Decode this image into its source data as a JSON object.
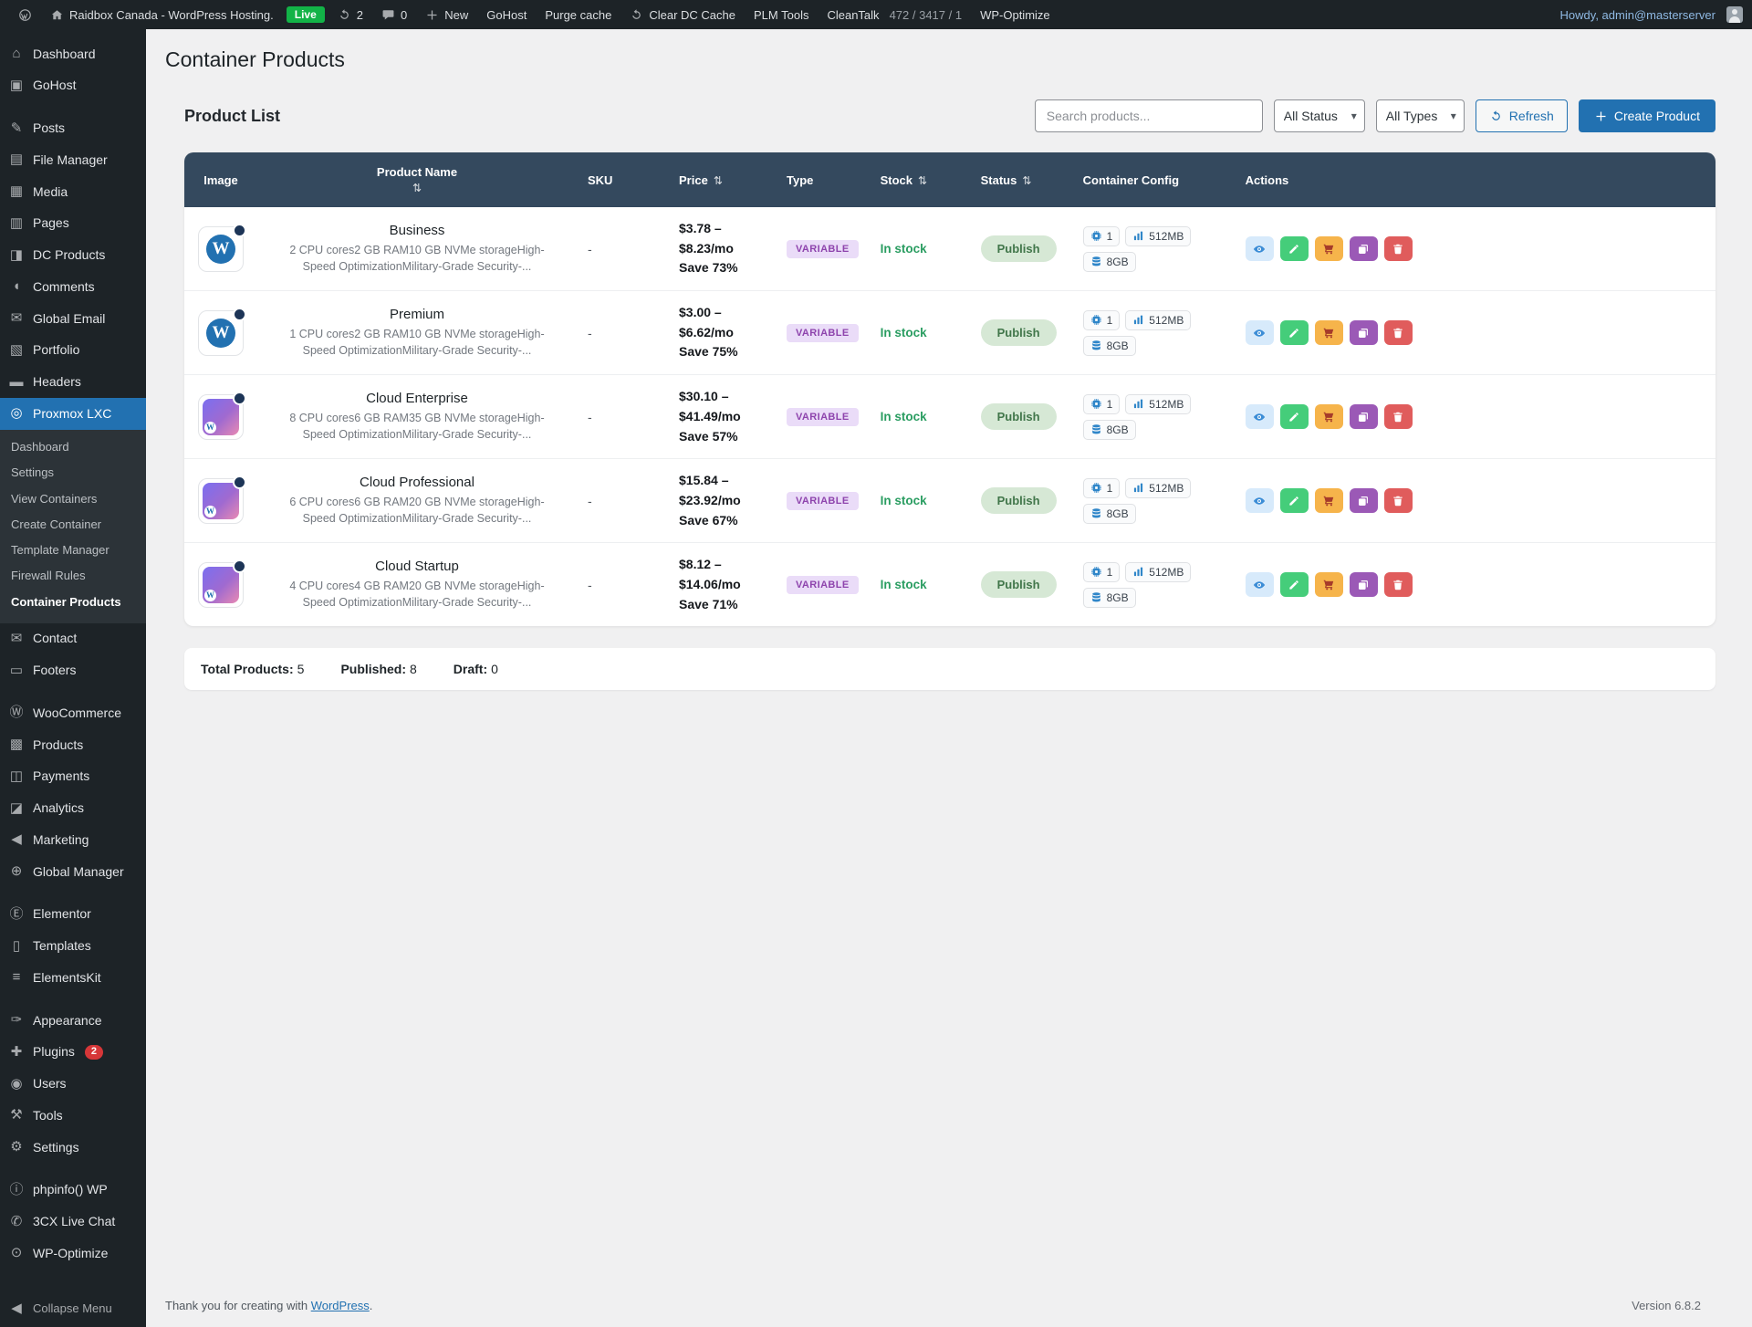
{
  "admin_bar": {
    "site_name": "Raidbox Canada - WordPress Hosting.",
    "live_badge": "Live",
    "updates_count": "2",
    "comments_count": "0",
    "new_label": "New",
    "menu_items": [
      "GoHost",
      "Purge cache",
      "Clear DC Cache",
      "PLM Tools"
    ],
    "cleantalk_label": "CleanTalk",
    "cleantalk_stats": "472 / 3417 / 1",
    "wp_optimize_label": "WP-Optimize",
    "howdy_text": "Howdy, admin@masterserver"
  },
  "sidebar": {
    "items": [
      {
        "label": "Dashboard",
        "icon": "dashboard-icon"
      },
      {
        "label": "GoHost",
        "icon": "gohost-icon"
      },
      {
        "separator": true
      },
      {
        "label": "Posts",
        "icon": "posts-icon"
      },
      {
        "label": "File Manager",
        "icon": "file-manager-icon"
      },
      {
        "label": "Media",
        "icon": "media-icon"
      },
      {
        "label": "Pages",
        "icon": "pages-icon"
      },
      {
        "label": "DC Products",
        "icon": "dc-products-icon"
      },
      {
        "label": "Comments",
        "icon": "comments-icon"
      },
      {
        "label": "Global Email",
        "icon": "global-email-icon"
      },
      {
        "label": "Portfolio",
        "icon": "portfolio-icon"
      },
      {
        "label": "Headers",
        "icon": "headers-icon"
      },
      {
        "label": "Proxmox LXC",
        "icon": "proxmox-icon",
        "active": true,
        "submenu": [
          "Dashboard",
          "Settings",
          "View Containers",
          "Create Container",
          "Template Manager",
          "Firewall Rules",
          "Container Products"
        ],
        "submenu_active": "Container Products"
      },
      {
        "label": "Contact",
        "icon": "contact-icon"
      },
      {
        "label": "Footers",
        "icon": "footers-icon"
      },
      {
        "separator": true
      },
      {
        "label": "WooCommerce",
        "icon": "woocommerce-icon"
      },
      {
        "label": "Products",
        "icon": "products-icon"
      },
      {
        "label": "Payments",
        "icon": "payments-icon"
      },
      {
        "label": "Analytics",
        "icon": "analytics-icon"
      },
      {
        "label": "Marketing",
        "icon": "marketing-icon"
      },
      {
        "label": "Global Manager",
        "icon": "global-manager-icon"
      },
      {
        "separator": true
      },
      {
        "label": "Elementor",
        "icon": "elementor-icon"
      },
      {
        "label": "Templates",
        "icon": "templates-icon"
      },
      {
        "label": "ElementsKit",
        "icon": "elementskit-icon"
      },
      {
        "separator": true
      },
      {
        "label": "Appearance",
        "icon": "appearance-icon"
      },
      {
        "label": "Plugins",
        "icon": "plugins-icon",
        "badge": "2"
      },
      {
        "label": "Users",
        "icon": "users-icon"
      },
      {
        "label": "Tools",
        "icon": "tools-icon"
      },
      {
        "label": "Settings",
        "icon": "settings-icon"
      },
      {
        "separator": true
      },
      {
        "label": "phpinfo() WP",
        "icon": "phpinfo-icon"
      },
      {
        "label": "3CX Live Chat",
        "icon": "3cx-icon"
      },
      {
        "label": "WP-Optimize",
        "icon": "wp-optimize-icon"
      }
    ],
    "collapse_label": "Collapse Menu"
  },
  "page": {
    "title": "Container Products",
    "section_title": "Product List"
  },
  "controls": {
    "search_placeholder": "Search products...",
    "status_filter_value": "All Status",
    "type_filter_value": "All Types",
    "refresh_label": "Refresh",
    "create_label": "Create Product"
  },
  "table": {
    "columns": [
      {
        "label": "Image",
        "sortable": false
      },
      {
        "label": "Product Name",
        "sortable": true
      },
      {
        "label": "SKU",
        "sortable": false
      },
      {
        "label": "Price",
        "sortable": true
      },
      {
        "label": "Type",
        "sortable": false
      },
      {
        "label": "Stock",
        "sortable": true
      },
      {
        "label": "Status",
        "sortable": true
      },
      {
        "label": "Container Config",
        "sortable": false
      },
      {
        "label": "Actions",
        "sortable": false
      }
    ],
    "actions": [
      {
        "name": "view",
        "icon": "eye-icon"
      },
      {
        "name": "edit",
        "icon": "edit-icon"
      },
      {
        "name": "add-to-cart",
        "icon": "cart-icon"
      },
      {
        "name": "duplicate",
        "icon": "clone-icon"
      },
      {
        "name": "delete",
        "icon": "trash-icon"
      }
    ],
    "rows": [
      {
        "image_variant": "wp-logo",
        "name": "Business",
        "description": "2 CPU cores2 GB RAM10 GB NVMe storageHigh-Speed OptimizationMilitary-Grade Security-...",
        "sku": "-",
        "price": "$3.78 – $8.23/mo Save 73%",
        "type": "VARIABLE",
        "stock": "In stock",
        "status": "Publish",
        "config": [
          {
            "icon": "cpu-icon",
            "label": "1"
          },
          {
            "icon": "memory-icon",
            "label": "512MB"
          },
          {
            "icon": "storage-icon",
            "label": "8GB"
          }
        ]
      },
      {
        "image_variant": "wp-logo",
        "name": "Premium",
        "description": "1 CPU cores2 GB RAM10 GB NVMe storageHigh-Speed OptimizationMilitary-Grade Security-...",
        "sku": "-",
        "price": "$3.00 – $6.62/mo Save 75%",
        "type": "VARIABLE",
        "stock": "In stock",
        "status": "Publish",
        "config": [
          {
            "icon": "cpu-icon",
            "label": "1"
          },
          {
            "icon": "memory-icon",
            "label": "512MB"
          },
          {
            "icon": "storage-icon",
            "label": "8GB"
          }
        ]
      },
      {
        "image_variant": "purple-rocket",
        "name": "Cloud Enterprise",
        "description": "8 CPU cores6 GB RAM35 GB NVMe storageHigh-Speed OptimizationMilitary-Grade Security-...",
        "sku": "-",
        "price": "$30.10 – $41.49/mo Save 57%",
        "type": "VARIABLE",
        "stock": "In stock",
        "status": "Publish",
        "config": [
          {
            "icon": "cpu-icon",
            "label": "1"
          },
          {
            "icon": "memory-icon",
            "label": "512MB"
          },
          {
            "icon": "storage-icon",
            "label": "8GB"
          }
        ]
      },
      {
        "image_variant": "purple-rocket",
        "name": "Cloud Professional",
        "description": "6 CPU cores6 GB RAM20 GB NVMe storageHigh-Speed OptimizationMilitary-Grade Security-...",
        "sku": "-",
        "price": "$15.84 – $23.92/mo Save 67%",
        "type": "VARIABLE",
        "stock": "In stock",
        "status": "Publish",
        "config": [
          {
            "icon": "cpu-icon",
            "label": "1"
          },
          {
            "icon": "memory-icon",
            "label": "512MB"
          },
          {
            "icon": "storage-icon",
            "label": "8GB"
          }
        ]
      },
      {
        "image_variant": "purple-rocket",
        "name": "Cloud Startup",
        "description": "4 CPU cores4 GB RAM20 GB NVMe storageHigh-Speed OptimizationMilitary-Grade Security-...",
        "sku": "-",
        "price": "$8.12 – $14.06/mo Save 71%",
        "type": "VARIABLE",
        "stock": "In stock",
        "status": "Publish",
        "config": [
          {
            "icon": "cpu-icon",
            "label": "1"
          },
          {
            "icon": "memory-icon",
            "label": "512MB"
          },
          {
            "icon": "storage-icon",
            "label": "8GB"
          }
        ]
      }
    ]
  },
  "stats": [
    {
      "label": "Total Products:",
      "value": "5"
    },
    {
      "label": "Published:",
      "value": "8"
    },
    {
      "label": "Draft:",
      "value": "0"
    }
  ],
  "footer": {
    "thanks_prefix": "Thank you for creating with ",
    "link_label": "WordPress",
    "thanks_suffix": ".",
    "version": "Version 6.8.2"
  },
  "colors": {
    "accent_blue": "#2271b1",
    "table_header": "#34495e",
    "stock_green": "#2a9d61",
    "live_badge_green": "#12b347",
    "type_badge_purple": "#8e44ad",
    "danger_red": "#d63638"
  }
}
